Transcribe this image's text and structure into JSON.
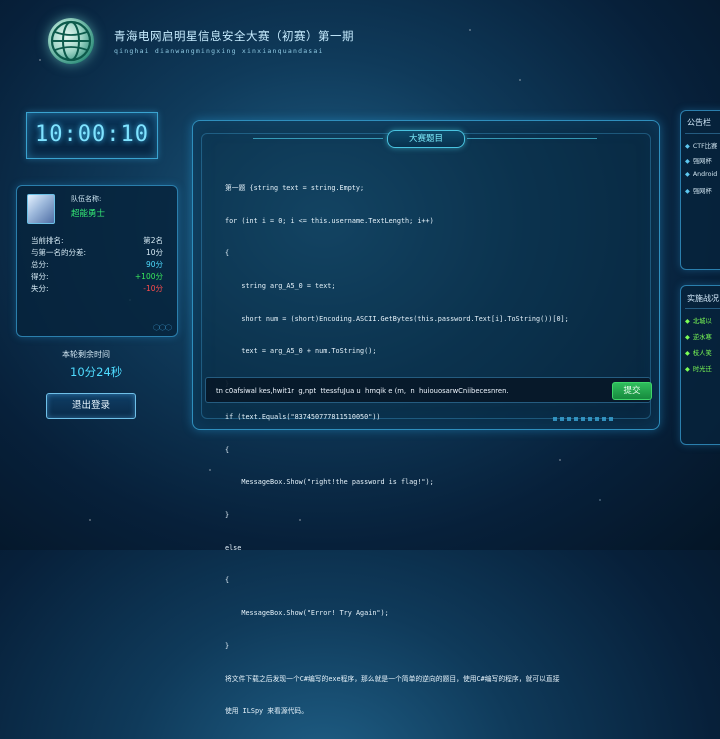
{
  "header": {
    "title_cn": "青海电网启明星信息安全大赛（初赛）第一期",
    "title_pinyin": "qinghai   dianwangmingxing   xinxianquandasai",
    "logo_icon": "globe-logo-icon"
  },
  "timer": {
    "value": "10:00:10"
  },
  "team": {
    "name_label": "队伍名称:",
    "name": "超能勇士",
    "rank_label": "当前排名:",
    "rank": "第2名",
    "gap_label": "与第一名的分差:",
    "gap": "10分",
    "total_label": "总分:",
    "total": "90分",
    "gain_label": "得分:",
    "gain": "+100分",
    "loss_label": "失分:",
    "loss": "-10分",
    "colors": {
      "green": "#38e85c",
      "red": "#ff4c4c",
      "cyan": "#4fdcff"
    }
  },
  "remaining": {
    "label": "本轮剩余时间",
    "value": "10分24秒"
  },
  "logout_button": "退出登录",
  "main": {
    "tab_title": "大赛题目",
    "problem_lines": [
      "第一题 {string text = string.Empty;",
      "for (int i = 0; i <= this.username.TextLength; i++)",
      "{",
      "    string arg_A5_0 = text;",
      "    short num = (short)Encoding.ASCII.GetBytes(this.password.Text[i].ToString())[0];",
      "    text = arg_A5_0 + num.ToString();",
      "}",
      "if (text.Equals(\"837450777811510050\"))",
      "{",
      "    MessageBox.Show(\"right!the password is flag!\");",
      "}",
      "else",
      "{",
      "    MessageBox.Show(\"Error! Try Again\");",
      "}",
      "将文件下载之后发现一个C#编写的exe程序，那么就是一个简单的逆向的题目，使用C#编写的程序，就可以直接",
      "使用 ILSpy 来看源代码。"
    ],
    "answer_value": "tn c0afsiwal kes,hwit1r  g,npt  ttessfuJua u  hmqik e (m,  n  huiouosarwCniibecesnren.",
    "submit_label": "提交"
  },
  "announcements": {
    "title": "公告栏",
    "items": [
      "CTF比赛",
      "强网杯",
      "Android",
      "强网杯"
    ]
  },
  "dynamics": {
    "title": "实施战况",
    "items": [
      "北城以",
      "逆水寒",
      "枝人笑",
      "时光迁"
    ]
  }
}
